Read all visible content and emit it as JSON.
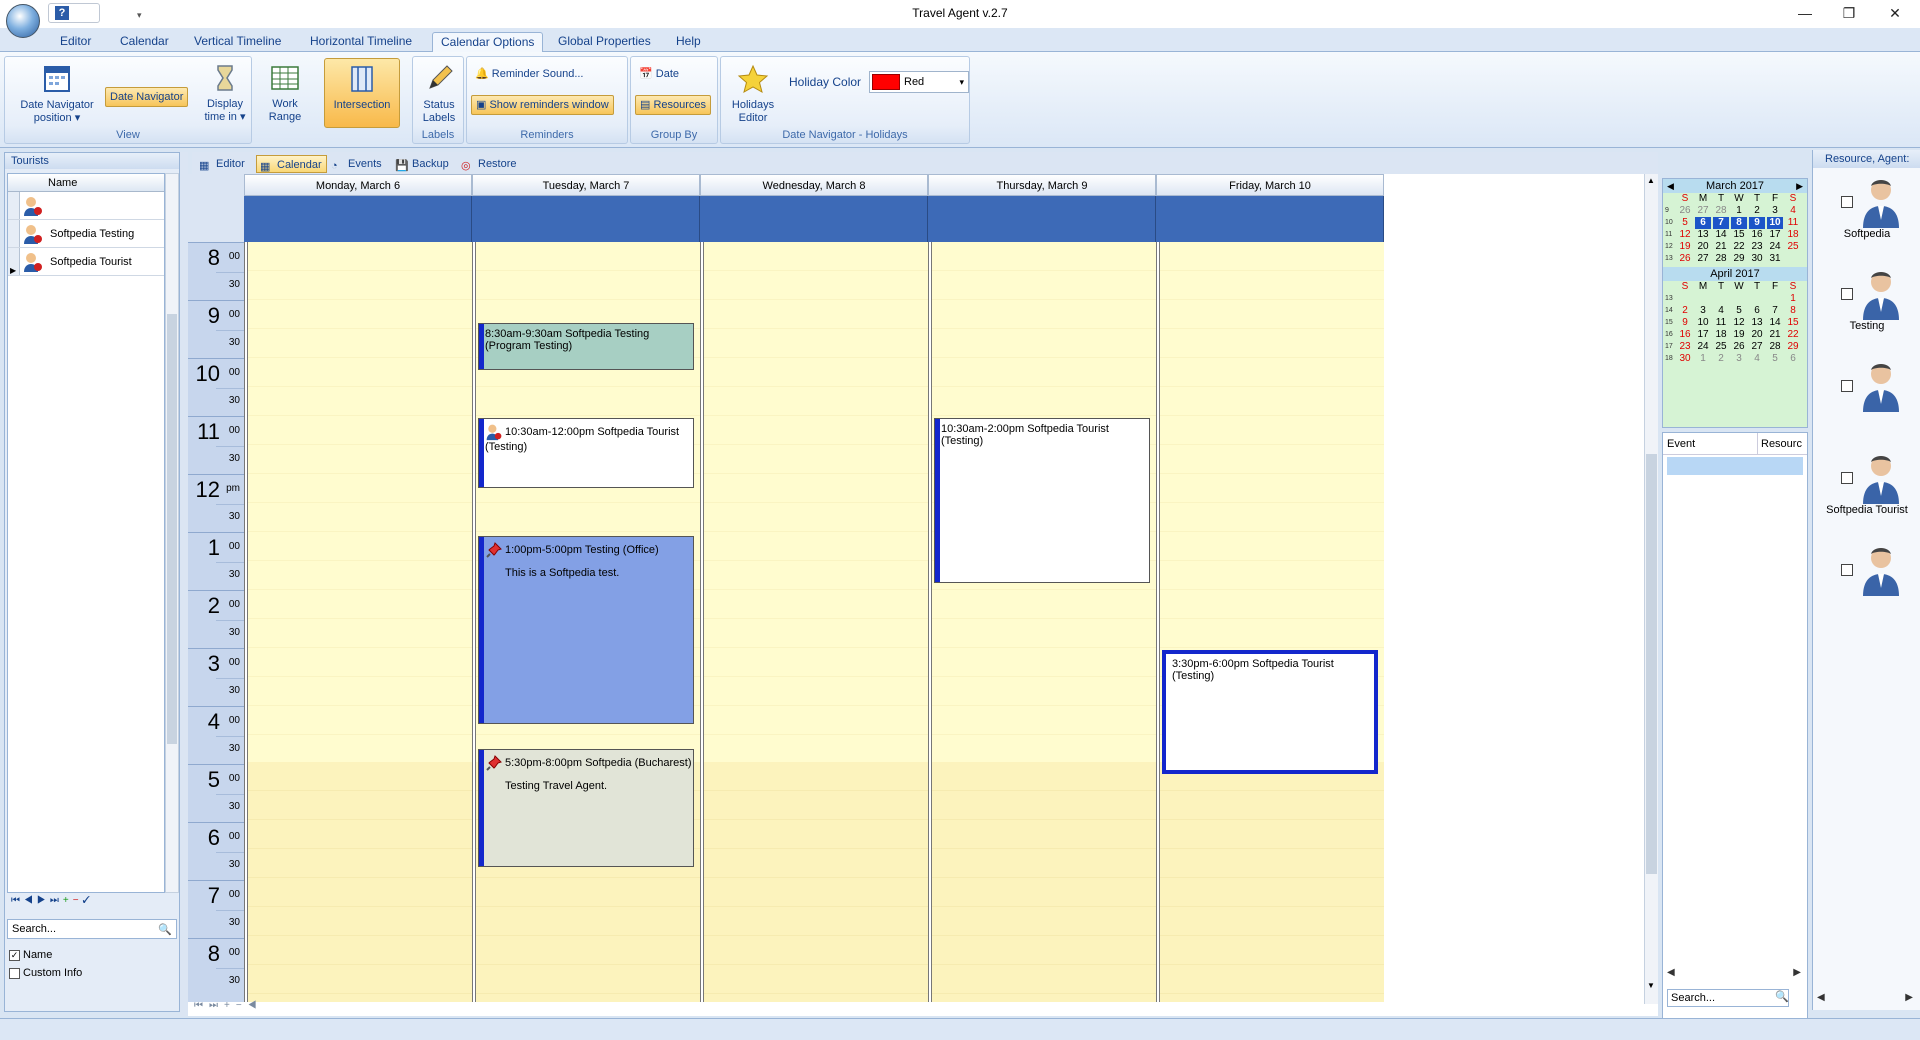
{
  "app": {
    "title": "Travel Agent v.2.7"
  },
  "ribbon_tabs": [
    "Editor",
    "Calendar",
    "Vertical Timeline",
    "Horizontal Timeline",
    "Calendar Options",
    "Global Properties",
    "Help"
  ],
  "ribbon": {
    "view": {
      "label": "View",
      "date_nav_pos": "Date Navigator position",
      "date_navigator": "Date Navigator",
      "display_time": "Display time in",
      "work_range": "Work Range"
    },
    "intersection": {
      "label": "Intersection"
    },
    "labels": {
      "label": "Labels",
      "status_labels": "Status Labels"
    },
    "reminders": {
      "label": "Reminders",
      "reminder_sound": "Reminder Sound...",
      "show_window": "Show reminders window"
    },
    "group_by": {
      "label": "Group By",
      "date": "Date",
      "resources": "Resources"
    },
    "holidays": {
      "label": "Date Navigator - Holidays",
      "editor": "Holidays Editor",
      "color_label": "Holiday Color",
      "color_value": "Red",
      "color_hex": "#ff0000"
    }
  },
  "tourists": {
    "title": "Tourists",
    "col_name": "Name",
    "rows": [
      "",
      "Softpedia Testing",
      "Softpedia Tourist"
    ],
    "search_placeholder": "Search...",
    "opt_name": "Name",
    "opt_custom": "Custom Info"
  },
  "cal_tabs": [
    "Editor",
    "Calendar",
    "Events",
    "Backup",
    "Restore"
  ],
  "days": [
    "Monday, March 6",
    "Tuesday, March 7",
    "Wednesday, March 8",
    "Thursday, March 9",
    "Friday, March 10"
  ],
  "hours": [
    {
      "h": "8",
      "m": "00"
    },
    {
      "h": "9",
      "m": "00"
    },
    {
      "h": "10",
      "m": "00"
    },
    {
      "h": "11",
      "m": "00"
    },
    {
      "h": "12",
      "m": "pm"
    },
    {
      "h": "1",
      "m": "00"
    },
    {
      "h": "2",
      "m": "00"
    },
    {
      "h": "3",
      "m": "00"
    },
    {
      "h": "4",
      "m": "00"
    },
    {
      "h": "5",
      "m": "00"
    },
    {
      "h": "6",
      "m": "00"
    },
    {
      "h": "7",
      "m": "00"
    },
    {
      "h": "8",
      "m": "00"
    }
  ],
  "half_label": "30",
  "appointments": [
    {
      "day": 1,
      "title": "8:30am-9:30am Softpedia Testing (Program Testing)",
      "desc": "",
      "color": "#a7cfc3",
      "icon": ""
    },
    {
      "day": 1,
      "title": "10:30am-12:00pm Softpedia Tourist (Testing)",
      "desc": "",
      "color": "#ffffff",
      "icon": "tourist"
    },
    {
      "day": 1,
      "title": "1:00pm-5:00pm Testing (Office)",
      "desc": "This is a Softpedia test.",
      "color": "#83a0e5",
      "icon": "pin"
    },
    {
      "day": 1,
      "title": "5:30pm-8:00pm Softpedia (Bucharest)",
      "desc": "Testing Travel Agent.",
      "color": "#e1e4d7",
      "icon": "pin"
    },
    {
      "day": 3,
      "title": "10:30am-2:00pm Softpedia Tourist (Testing)",
      "desc": "",
      "color": "#ffffff",
      "icon": ""
    },
    {
      "day": 4,
      "title": "3:30pm-6:00pm Softpedia Tourist (Testing)",
      "desc": "",
      "color": "#ffffff",
      "icon": ""
    }
  ],
  "minical": {
    "dow": [
      "S",
      "M",
      "T",
      "W",
      "T",
      "F",
      "S"
    ],
    "march": {
      "title": "March 2017",
      "weeks": [
        {
          "wk": "9",
          "days": [
            "26",
            "27",
            "28",
            "1",
            "2",
            "3",
            "4"
          ]
        },
        {
          "wk": "10",
          "days": [
            "5",
            "6",
            "7",
            "8",
            "9",
            "10",
            "11"
          ]
        },
        {
          "wk": "11",
          "days": [
            "12",
            "13",
            "14",
            "15",
            "16",
            "17",
            "18"
          ]
        },
        {
          "wk": "12",
          "days": [
            "19",
            "20",
            "21",
            "22",
            "23",
            "24",
            "25"
          ]
        },
        {
          "wk": "13",
          "days": [
            "26",
            "27",
            "28",
            "29",
            "30",
            "31",
            ""
          ]
        }
      ]
    },
    "april": {
      "title": "April 2017",
      "weeks": [
        {
          "wk": "13",
          "days": [
            "",
            "",
            "",
            "",
            "",
            "",
            "1"
          ]
        },
        {
          "wk": "14",
          "days": [
            "2",
            "3",
            "4",
            "5",
            "6",
            "7",
            "8"
          ]
        },
        {
          "wk": "15",
          "days": [
            "9",
            "10",
            "11",
            "12",
            "13",
            "14",
            "15"
          ]
        },
        {
          "wk": "16",
          "days": [
            "16",
            "17",
            "18",
            "19",
            "20",
            "21",
            "22"
          ]
        },
        {
          "wk": "17",
          "days": [
            "23",
            "24",
            "25",
            "26",
            "27",
            "28",
            "29"
          ]
        },
        {
          "wk": "18",
          "days": [
            "30",
            "1",
            "2",
            "3",
            "4",
            "5",
            "6"
          ]
        }
      ]
    }
  },
  "events_panel": {
    "col_event": "Event",
    "col_resource": "Resourc",
    "search_placeholder": "Search..."
  },
  "resources": {
    "title": "Resource, Agent:",
    "items": [
      "Softpedia",
      "Testing",
      "",
      "Softpedia Tourist",
      ""
    ]
  }
}
